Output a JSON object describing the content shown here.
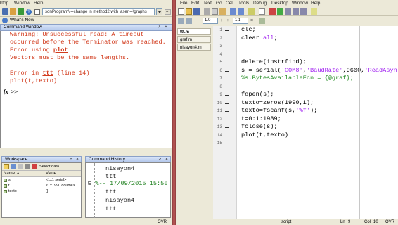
{
  "left_window": {
    "menu": [
      "ktop",
      "Window",
      "Help"
    ],
    "current_folder": "sor\\Program\\---change in method2 with laser---\\graphs",
    "shortcuts": "What's New",
    "command_window": {
      "title": "Command Window",
      "lines": [
        {
          "text": "Warning: Unsuccessful read: A timeout",
          "kind": "err"
        },
        {
          "text": "occurred before the Terminator was reached.",
          "kind": "err"
        },
        {
          "text": "Error using ",
          "kind": "err",
          "link": "plot"
        },
        {
          "text": "Vectors must be the same lengths.",
          "kind": "err"
        },
        {
          "text": "",
          "kind": "blank"
        },
        {
          "text": "Error in ",
          "kind": "err",
          "link": "ttt",
          "suffix": " (line 14)"
        },
        {
          "text": "plot(t,texto)",
          "kind": "err"
        }
      ],
      "prompt": ">>",
      "fx": "fx"
    },
    "workspace": {
      "title": "Workspace",
      "select_label": "Select data ...",
      "columns": [
        "Name ▲",
        "Value"
      ],
      "rows": [
        {
          "name": "s",
          "value": "<1x1 serial>"
        },
        {
          "name": "t",
          "value": "<1x1990 double>"
        },
        {
          "name": "texto",
          "value": "[]"
        }
      ]
    },
    "history": {
      "title": "Command History",
      "lines": [
        "nisayon4",
        "ttt",
        "%-- 17/09/2015 15:50",
        "ttt",
        "nisayon4",
        "ttt"
      ]
    },
    "status": "OVR"
  },
  "editor": {
    "menu": [
      "File",
      "Edit",
      "Text",
      "Go",
      "Cell",
      "Tools",
      "Debug",
      "Desktop",
      "Window",
      "Help"
    ],
    "cell_values": {
      "a": "1.0",
      "b": "1.1"
    },
    "tabs": [
      "ttt.m",
      "graf.m",
      "nisayon4.m"
    ],
    "line_numbers": [
      "1",
      "2",
      "3",
      "4",
      "5",
      "6",
      "7",
      "8",
      "9",
      "10",
      "11",
      "12",
      "13",
      "14",
      "15"
    ],
    "code": [
      {
        "n": "1",
        "dash": true,
        "segments": [
          {
            "t": "clc;"
          }
        ]
      },
      {
        "n": "2",
        "dash": true,
        "segments": [
          {
            "t": "clear "
          },
          {
            "t": "all",
            "c": "str"
          },
          {
            "t": ";"
          }
        ]
      },
      {
        "n": "3",
        "dash": false,
        "segments": [
          {
            "t": ""
          }
        ]
      },
      {
        "n": "4",
        "dash": false,
        "segments": [
          {
            "t": ""
          }
        ]
      },
      {
        "n": "5",
        "dash": true,
        "segments": [
          {
            "t": "delete(instrfind);"
          }
        ]
      },
      {
        "n": "6",
        "dash": true,
        "segments": [
          {
            "t": "s = serial("
          },
          {
            "t": "'COM8'",
            "c": "str"
          },
          {
            "t": ","
          },
          {
            "t": "'BaudRate'",
            "c": "str"
          },
          {
            "t": ",9600,"
          },
          {
            "t": "'ReadAsyn",
            "c": "str"
          }
        ]
      },
      {
        "n": "7",
        "dash": false,
        "segments": [
          {
            "t": "%s.BytesAvailableFcn = {@graf};",
            "c": "cmt"
          }
        ]
      },
      {
        "n": "8",
        "dash": false,
        "segments": [
          {
            "t": ""
          }
        ]
      },
      {
        "n": "9",
        "dash": true,
        "segments": [
          {
            "t": "fopen(s);"
          }
        ]
      },
      {
        "n": "10",
        "dash": true,
        "segments": [
          {
            "t": "texto=zeros(1990,1);"
          }
        ]
      },
      {
        "n": "11",
        "dash": true,
        "segments": [
          {
            "t": "texto=fscanf(s,"
          },
          {
            "t": "'%f'",
            "c": "str"
          },
          {
            "t": ");"
          }
        ]
      },
      {
        "n": "12",
        "dash": true,
        "segments": [
          {
            "t": "t=0:1:1989;"
          }
        ]
      },
      {
        "n": "13",
        "dash": true,
        "segments": [
          {
            "t": "fclose(s);"
          }
        ]
      },
      {
        "n": "14",
        "dash": true,
        "segments": [
          {
            "t": "plot(t,texto)"
          }
        ]
      },
      {
        "n": "15",
        "dash": false,
        "segments": [
          {
            "t": ""
          }
        ]
      }
    ],
    "status": {
      "mode": "script",
      "ln_label": "Ln",
      "ln": "9",
      "col_label": "Col",
      "col": "10",
      "ovr": "OVR"
    }
  }
}
